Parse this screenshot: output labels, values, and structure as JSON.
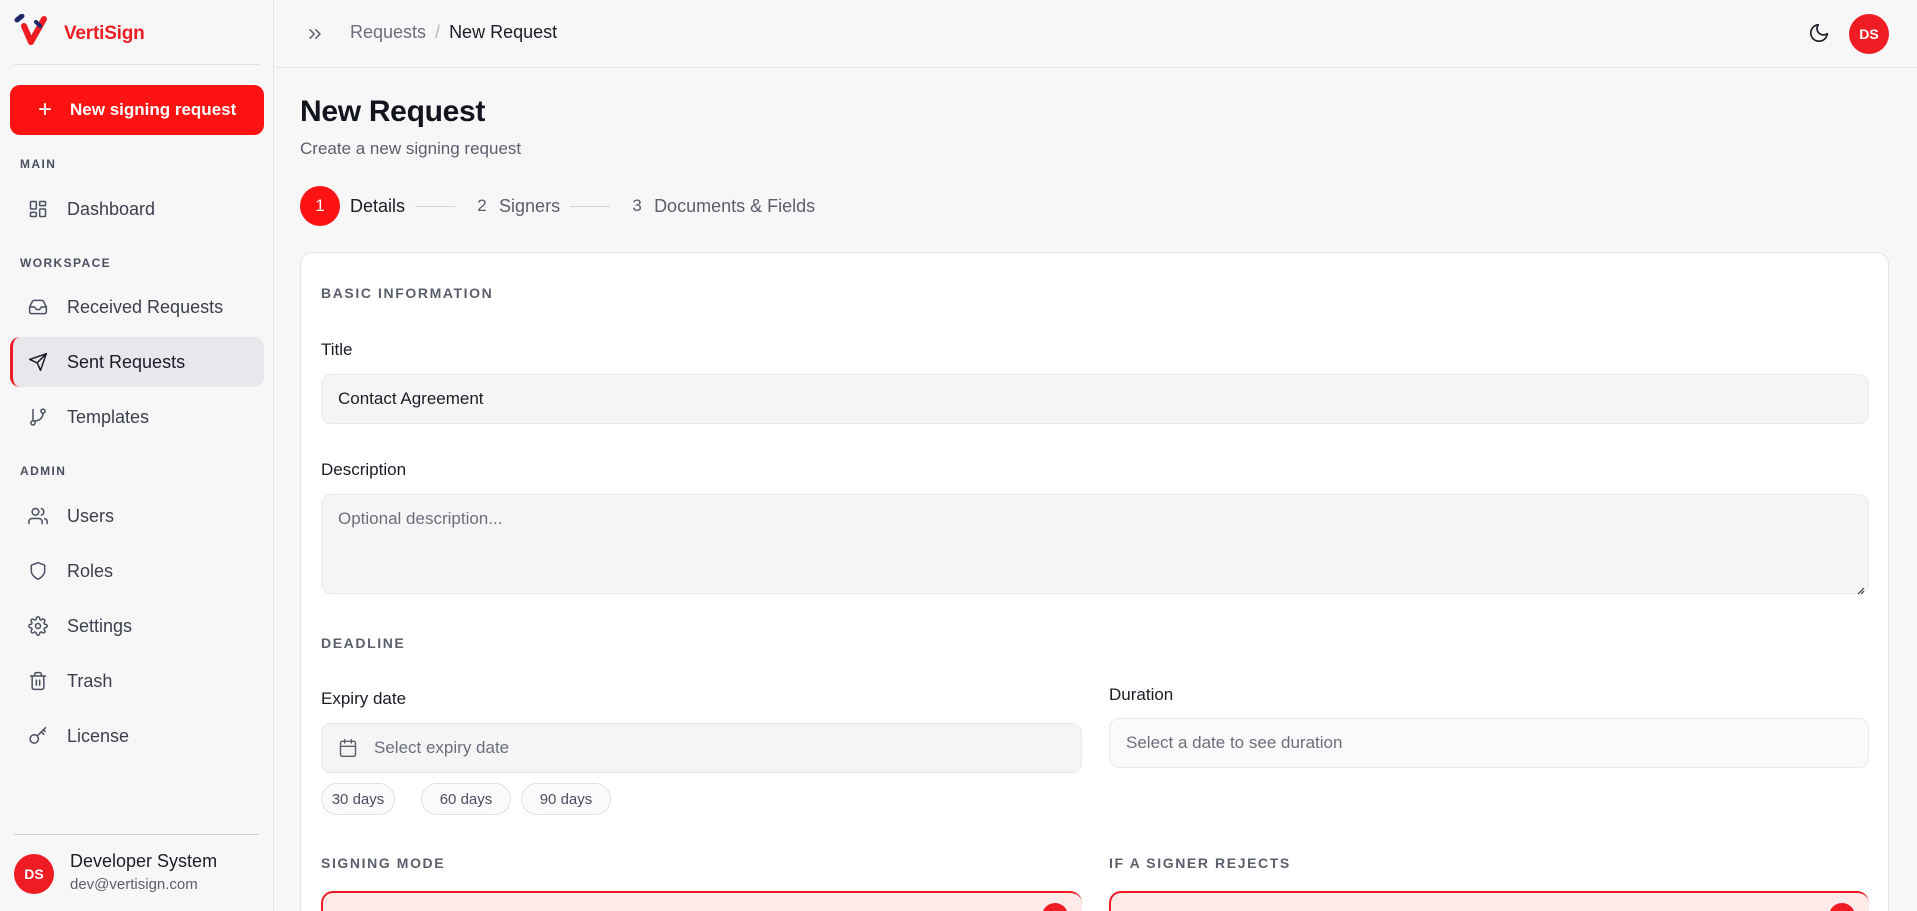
{
  "app": {
    "name": "VertiSign",
    "brand_color": "#ef1c24"
  },
  "sidebar": {
    "new_button_label": "New signing request",
    "sections": {
      "main": "MAIN",
      "workspace": "WORKSPACE",
      "admin": "ADMIN"
    },
    "items": [
      {
        "label": "Dashboard",
        "icon": "dashboard-icon"
      },
      {
        "label": "Received Requests",
        "icon": "inbox-icon"
      },
      {
        "label": "Sent Requests",
        "icon": "send-icon",
        "active": true
      },
      {
        "label": "Templates",
        "icon": "git-branch-icon"
      },
      {
        "label": "Users",
        "icon": "users-icon"
      },
      {
        "label": "Roles",
        "icon": "shield-icon"
      },
      {
        "label": "Settings",
        "icon": "gear-icon"
      },
      {
        "label": "Trash",
        "icon": "trash-icon"
      },
      {
        "label": "License",
        "icon": "key-icon"
      }
    ],
    "user": {
      "initials": "DS",
      "name": "Developer System",
      "email": "dev@vertisign.com"
    }
  },
  "topbar": {
    "breadcrumb": [
      "Requests",
      "New Request"
    ],
    "breadcrumb_separator": "/",
    "avatar_initials": "DS"
  },
  "page": {
    "title": "New Request",
    "subtitle": "Create a new signing request"
  },
  "stepper": [
    {
      "number": "1",
      "label": "Details",
      "active": true
    },
    {
      "number": "2",
      "label": "Signers",
      "active": false
    },
    {
      "number": "3",
      "label": "Documents & Fields",
      "active": false
    }
  ],
  "form": {
    "basic_section": "BASIC INFORMATION",
    "title_label": "Title",
    "title_value": "Contact Agreement",
    "description_label": "Description",
    "description_placeholder": "Optional description...",
    "deadline_section": "DEADLINE",
    "expiry_label": "Expiry date",
    "expiry_placeholder": "Select expiry date",
    "duration_label": "Duration",
    "duration_placeholder": "Select a date to see duration",
    "quick_options": [
      "30 days",
      "60 days",
      "90 days"
    ],
    "signing_mode_section": "SIGNING MODE",
    "reject_section": "IF A SIGNER REJECTS"
  }
}
